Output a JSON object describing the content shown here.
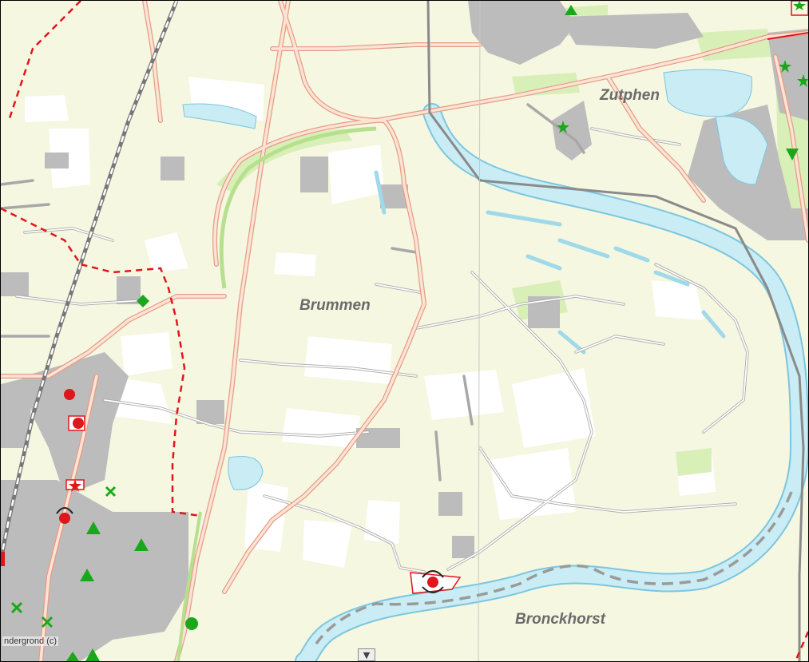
{
  "map": {
    "places": [
      {
        "id": "zutphen",
        "name": "Zutphen"
      },
      {
        "id": "brummen",
        "name": "Brummen"
      },
      {
        "id": "bronckhorst",
        "name": "Bronckhorst"
      }
    ],
    "copyright": "ndergrond (c)",
    "toggle_icon": "chevron-down-icon",
    "colors": {
      "land": "#f5f7e1",
      "river": "#c9ecf5",
      "road_major": "#f0b9a0",
      "railway": "#8a8a8a",
      "boundary": "#e0161d",
      "urban": "#bcbcbc",
      "green_marker": "#1aa81a",
      "red_marker": "#e0161d"
    },
    "markers": [
      "green-triangle",
      "green-star",
      "green-cross",
      "green-diamond",
      "red-circle",
      "red-star"
    ]
  }
}
